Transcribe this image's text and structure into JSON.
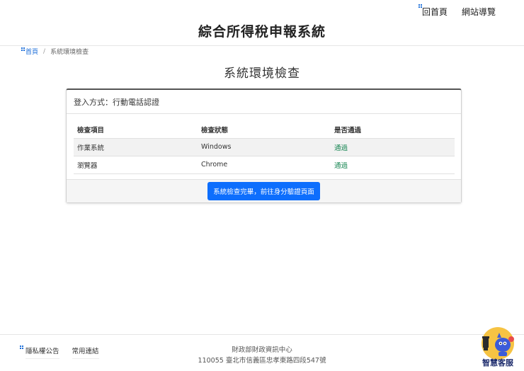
{
  "topnav": {
    "home": "回首頁",
    "sitemap": "網站導覽"
  },
  "site_title": "綜合所得稅申報系統",
  "breadcrumb": {
    "home": "首頁",
    "separator": "/",
    "current": "系統環境檢查"
  },
  "page_title": "系統環境檢查",
  "card": {
    "login_method": "登入方式：行動電話認證",
    "columns": [
      "檢查項目",
      "檢查狀態",
      "是否通過"
    ],
    "rows": [
      {
        "item": "作業系統",
        "status": "Windows",
        "result": "通過"
      },
      {
        "item": "瀏覽器",
        "status": "Chrome",
        "result": "通過"
      }
    ],
    "button_label": "系統檢查完畢，前往身分驗證頁面"
  },
  "footer": {
    "links": [
      "隱私權公告",
      "常用連結"
    ],
    "org": "財政部財政資訊中心",
    "address": "110055 臺北市信義區忠孝東路四段547號"
  },
  "service_widget": {
    "label": "智慧客服"
  },
  "colors": {
    "primary": "#0d6efd",
    "pass": "#198754",
    "link": "#1e6fd9"
  }
}
